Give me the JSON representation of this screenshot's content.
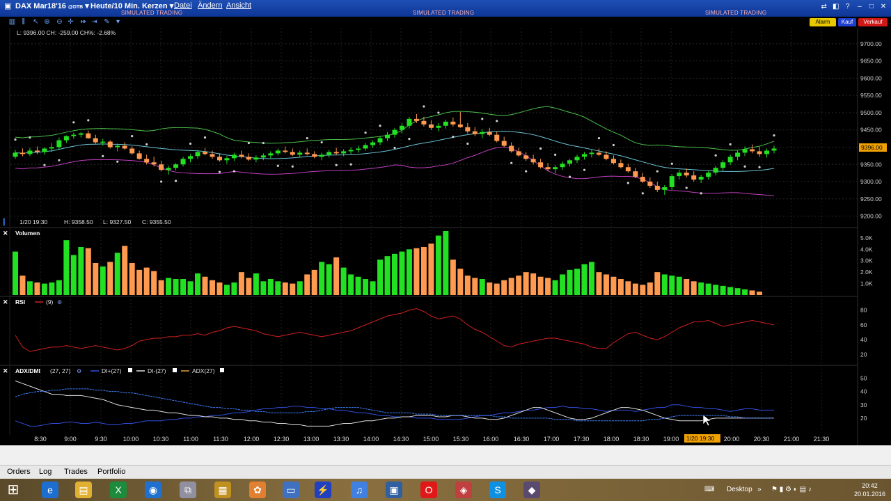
{
  "app": {
    "instrument": "DAX Mar18'16",
    "exchange": "@DTB",
    "timeframe": "Heute/10 Min. Kerzen",
    "menu": [
      "Datei",
      "Ändern",
      "Ansicht"
    ],
    "simulated": "SIMULATED TRADING"
  },
  "order_buttons": {
    "alarm": "Alarm",
    "kauf": "Kauf",
    "verkauf": "Verkauf"
  },
  "price_info": "L: 9396.00 CH: -259.00 CH%: -2.68%",
  "bar_info": {
    "time": "1/20 19:30",
    "h": "H: 9358.50",
    "l": "L: 9327.50",
    "c": "C: 9355.50"
  },
  "panels": {
    "volume": {
      "label": "Volumen"
    },
    "rsi": {
      "label": "RSI",
      "param": "(9)"
    },
    "adx": {
      "label": "ADX/DMI",
      "param": "(27, 27)",
      "di_plus": "DI+(27)",
      "di_minus": "DI-(27)",
      "adx": "ADX(27)"
    }
  },
  "colors": {
    "up": "#22e022",
    "down": "#ff9a50",
    "bb_upper": "#4cc24c",
    "bb_mid": "#6cc6d6",
    "bb_lower": "#c040c0",
    "psar": "#d0d0d0",
    "rsi": "#d02020",
    "di_plus": "#3050e0",
    "di_minus": "#e0e0e0",
    "adx_line": "#4080ff",
    "price_badge": "#f0a000",
    "time_badge": "#f0a000"
  },
  "price_axis": {
    "labels": [
      "9700.00",
      "9650.00",
      "9600.00",
      "9550.00",
      "9500.00",
      "9450.00",
      "9400.00",
      "9350.00",
      "9300.00",
      "9250.00",
      "9200.00"
    ],
    "current": "9396.00"
  },
  "volume_axis": [
    "5.0K",
    "4.0K",
    "3.0K",
    "2.0K",
    "1.0K"
  ],
  "rsi_axis": [
    "80",
    "60",
    "40",
    "20"
  ],
  "adx_axis": [
    "50",
    "40",
    "30",
    "20"
  ],
  "time_axis": [
    "8:30",
    "9:00",
    "9:30",
    "10:00",
    "10:30",
    "11:00",
    "11:30",
    "12:00",
    "12:30",
    "13:00",
    "13:30",
    "14:00",
    "14:30",
    "15:00",
    "15:30",
    "16:00",
    "16:30",
    "17:00",
    "17:30",
    "18:00",
    "18:30",
    "19:00",
    "20:00",
    "20:30",
    "21:00",
    "21:30"
  ],
  "time_badge": "1/20 19:30",
  "bottom_tabs": [
    "Orders",
    "Log",
    "Trades",
    "Portfolio"
  ],
  "taskbar": {
    "desktop": "Desktop",
    "time": "20:42",
    "date": "20.01.2016"
  },
  "chart_data": {
    "type": "candlestick",
    "y_range": [
      9185,
      9730
    ],
    "candles": [
      [
        9372,
        9392,
        9366,
        9384
      ],
      [
        9384,
        9396,
        9374,
        9380
      ],
      [
        9380,
        9398,
        9374,
        9390
      ],
      [
        9390,
        9402,
        9380,
        9386
      ],
      [
        9386,
        9400,
        9378,
        9396
      ],
      [
        9396,
        9412,
        9386,
        9400
      ],
      [
        9400,
        9428,
        9392,
        9420
      ],
      [
        9420,
        9434,
        9412,
        9432
      ],
      [
        9432,
        9442,
        9424,
        9436
      ],
      [
        9436,
        9444,
        9428,
        9440
      ],
      [
        9440,
        9448,
        9424,
        9426
      ],
      [
        9426,
        9436,
        9410,
        9414
      ],
      [
        9414,
        9424,
        9404,
        9416
      ],
      [
        9416,
        9420,
        9396,
        9400
      ],
      [
        9400,
        9410,
        9388,
        9404
      ],
      [
        9404,
        9414,
        9392,
        9396
      ],
      [
        9396,
        9402,
        9378,
        9382
      ],
      [
        9382,
        9390,
        9364,
        9366
      ],
      [
        9366,
        9378,
        9350,
        9356
      ],
      [
        9356,
        9372,
        9344,
        9350
      ],
      [
        9350,
        9360,
        9330,
        9334
      ],
      [
        9334,
        9346,
        9320,
        9340
      ],
      [
        9340,
        9354,
        9332,
        9350
      ],
      [
        9350,
        9372,
        9344,
        9366
      ],
      [
        9366,
        9380,
        9356,
        9374
      ],
      [
        9374,
        9392,
        9366,
        9386
      ],
      [
        9386,
        9398,
        9376,
        9380
      ],
      [
        9380,
        9390,
        9366,
        9372
      ],
      [
        9372,
        9382,
        9358,
        9362
      ],
      [
        9362,
        9374,
        9352,
        9368
      ],
      [
        9368,
        9384,
        9360,
        9378
      ],
      [
        9378,
        9390,
        9368,
        9372
      ],
      [
        9372,
        9382,
        9360,
        9364
      ],
      [
        9364,
        9376,
        9356,
        9370
      ],
      [
        9370,
        9382,
        9362,
        9376
      ],
      [
        9376,
        9388,
        9368,
        9382
      ],
      [
        9382,
        9396,
        9376,
        9390
      ],
      [
        9390,
        9402,
        9382,
        9386
      ],
      [
        9386,
        9396,
        9374,
        9378
      ],
      [
        9378,
        9390,
        9370,
        9384
      ],
      [
        9384,
        9396,
        9376,
        9380
      ],
      [
        9380,
        9388,
        9368,
        9372
      ],
      [
        9372,
        9384,
        9362,
        9378
      ],
      [
        9378,
        9392,
        9370,
        9386
      ],
      [
        9386,
        9398,
        9378,
        9382
      ],
      [
        9382,
        9394,
        9374,
        9388
      ],
      [
        9388,
        9400,
        9380,
        9392
      ],
      [
        9392,
        9404,
        9384,
        9396
      ],
      [
        9396,
        9412,
        9390,
        9406
      ],
      [
        9406,
        9420,
        9398,
        9414
      ],
      [
        9414,
        9432,
        9406,
        9426
      ],
      [
        9426,
        9444,
        9418,
        9436
      ],
      [
        9436,
        9456,
        9428,
        9450
      ],
      [
        9450,
        9470,
        9440,
        9462
      ],
      [
        9462,
        9488,
        9454,
        9482
      ],
      [
        9482,
        9496,
        9470,
        9476
      ],
      [
        9476,
        9488,
        9460,
        9466
      ],
      [
        9466,
        9478,
        9450,
        9456
      ],
      [
        9456,
        9470,
        9446,
        9462
      ],
      [
        9462,
        9480,
        9454,
        9474
      ],
      [
        9474,
        9486,
        9460,
        9466
      ],
      [
        9466,
        9502,
        9456,
        9458
      ],
      [
        9458,
        9470,
        9440,
        9446
      ],
      [
        9446,
        9458,
        9432,
        9438
      ],
      [
        9438,
        9452,
        9426,
        9444
      ],
      [
        9444,
        9456,
        9432,
        9436
      ],
      [
        9436,
        9446,
        9414,
        9418
      ],
      [
        9418,
        9430,
        9400,
        9404
      ],
      [
        9404,
        9414,
        9384,
        9388
      ],
      [
        9388,
        9398,
        9372,
        9376
      ],
      [
        9376,
        9386,
        9360,
        9366
      ],
      [
        9366,
        9378,
        9350,
        9356
      ],
      [
        9356,
        9366,
        9338,
        9342
      ],
      [
        9342,
        9354,
        9330,
        9336
      ],
      [
        9336,
        9348,
        9324,
        9342
      ],
      [
        9342,
        9358,
        9334,
        9352
      ],
      [
        9352,
        9366,
        9344,
        9362
      ],
      [
        9362,
        9378,
        9354,
        9372
      ],
      [
        9372,
        9386,
        9364,
        9380
      ],
      [
        9380,
        9392,
        9370,
        9384
      ],
      [
        9384,
        9396,
        9374,
        9378
      ],
      [
        9378,
        9388,
        9362,
        9366
      ],
      [
        9366,
        9376,
        9350,
        9354
      ],
      [
        9354,
        9364,
        9338,
        9342
      ],
      [
        9342,
        9352,
        9326,
        9330
      ],
      [
        9330,
        9340,
        9310,
        9314
      ],
      [
        9314,
        9326,
        9296,
        9300
      ],
      [
        9300,
        9312,
        9282,
        9288
      ],
      [
        9288,
        9300,
        9270,
        9276
      ],
      [
        9276,
        9290,
        9262,
        9284
      ],
      [
        9284,
        9322,
        9276,
        9316
      ],
      [
        9316,
        9334,
        9306,
        9326
      ],
      [
        9326,
        9338,
        9312,
        9318
      ],
      [
        9318,
        9330,
        9300,
        9306
      ],
      [
        9306,
        9320,
        9296,
        9314
      ],
      [
        9314,
        9332,
        9306,
        9326
      ],
      [
        9326,
        9346,
        9318,
        9340
      ],
      [
        9340,
        9362,
        9332,
        9356
      ],
      [
        9356,
        9378,
        9348,
        9372
      ],
      [
        9372,
        9390,
        9362,
        9384
      ],
      [
        9384,
        9402,
        9374,
        9394
      ],
      [
        9394,
        9408,
        9382,
        9388
      ],
      [
        9388,
        9400,
        9372,
        9380
      ],
      [
        9380,
        9396,
        9370,
        9390
      ],
      [
        9390,
        9404,
        9382,
        9396
      ]
    ],
    "volume": [
      3800,
      1700,
      1200,
      1100,
      1000,
      1100,
      1300,
      4800,
      3500,
      4200,
      4100,
      2800,
      2500,
      2900,
      3700,
      4300,
      2800,
      2200,
      2400,
      2100,
      1300,
      1500,
      1400,
      1400,
      1200,
      1900,
      1600,
      1300,
      1100,
      900,
      1100,
      2000,
      1500,
      1900,
      1200,
      1400,
      1200,
      1100,
      1000,
      1200,
      1800,
      2200,
      2900,
      2700,
      3300,
      2400,
      1800,
      1600,
      1400,
      1200,
      3100,
      3400,
      3600,
      3800,
      4000,
      4100,
      4200,
      4500,
      5200,
      5600,
      3100,
      2300,
      1700,
      1500,
      1400,
      1100,
      1000,
      1300,
      1500,
      1700,
      2000,
      1900,
      1600,
      1500,
      1300,
      1800,
      2200,
      2300,
      2700,
      2900,
      2000,
      1800,
      1600,
      1400,
      1200,
      1000,
      900,
      1100,
      2000,
      1800,
      1700,
      1600,
      1400,
      1200,
      1100,
      1000,
      900,
      800,
      700,
      600,
      500,
      400,
      300
    ],
    "rsi": [
      46,
      30,
      24,
      26,
      28,
      30,
      30,
      32,
      30,
      28,
      30,
      32,
      30,
      28,
      26,
      28,
      32,
      38,
      40,
      42,
      42,
      44,
      44,
      46,
      46,
      48,
      46,
      50,
      52,
      56,
      58,
      56,
      54,
      52,
      48,
      46,
      44,
      46,
      48,
      50,
      48,
      46,
      44,
      46,
      48,
      50,
      52,
      56,
      60,
      64,
      68,
      72,
      74,
      76,
      80,
      82,
      78,
      72,
      68,
      70,
      72,
      68,
      60,
      54,
      50,
      44,
      38,
      32,
      30,
      34,
      36,
      38,
      40,
      42,
      42,
      40,
      38,
      36,
      34,
      30,
      28,
      28,
      36,
      42,
      48,
      50,
      46,
      42,
      40,
      44,
      50,
      56,
      60,
      64,
      64,
      66,
      62,
      58,
      60,
      62,
      64,
      66,
      64,
      62,
      60
    ],
    "di_plus": [
      18,
      16,
      14,
      14,
      15,
      16,
      16,
      17,
      17,
      16,
      16,
      17,
      16,
      15,
      15,
      16,
      16,
      17,
      18,
      18,
      18,
      19,
      19,
      20,
      20,
      21,
      21,
      22,
      22,
      23,
      24,
      24,
      25,
      26,
      27,
      27,
      28,
      28,
      29,
      29,
      28,
      28,
      27,
      27,
      26,
      26,
      25,
      24,
      24,
      23,
      22,
      22,
      21,
      21,
      21,
      20,
      20,
      20,
      19,
      19,
      19,
      19,
      20,
      21,
      22,
      22,
      23,
      24,
      24,
      25,
      26,
      26,
      27,
      28,
      28,
      29,
      28,
      28,
      27,
      27,
      26,
      25,
      26,
      26,
      26,
      25,
      26,
      27,
      28,
      28,
      30,
      30,
      29,
      28,
      28,
      27,
      27,
      26,
      25,
      26,
      27,
      27,
      26,
      26,
      26
    ],
    "di_minus": [
      48,
      46,
      44,
      42,
      40,
      38,
      38,
      37,
      37,
      37,
      36,
      35,
      34,
      32,
      30,
      29,
      28,
      27,
      26,
      26,
      25,
      24,
      24,
      23,
      22,
      22,
      21,
      21,
      20,
      20,
      19,
      19,
      18,
      18,
      17,
      17,
      16,
      16,
      15,
      15,
      14,
      14,
      14,
      14,
      15,
      16,
      16,
      17,
      18,
      18,
      19,
      20,
      20,
      21,
      21,
      22,
      22,
      22,
      21,
      21,
      22,
      22,
      21,
      20,
      20,
      19,
      19,
      20,
      22,
      24,
      26,
      28,
      28,
      26,
      24,
      22,
      20,
      19,
      19,
      20,
      22,
      24,
      26,
      28,
      28,
      27,
      26,
      24,
      22,
      20,
      19,
      18,
      18,
      18,
      18,
      19,
      20,
      20,
      20,
      20,
      20,
      20,
      20,
      20,
      20
    ],
    "adx": [
      36,
      38,
      39,
      40,
      40,
      41,
      41,
      42,
      42,
      42,
      42,
      41,
      41,
      40,
      40,
      39,
      39,
      38,
      37,
      36,
      35,
      34,
      33,
      32,
      31,
      30,
      29,
      28,
      28,
      27,
      27,
      26,
      26,
      25,
      25,
      24,
      24,
      24,
      24,
      24,
      25,
      25,
      26,
      27,
      28,
      28,
      28,
      28,
      27,
      26,
      25,
      24,
      24,
      24,
      24,
      23,
      23,
      23,
      22,
      22,
      22,
      22,
      22,
      22,
      22,
      22,
      21,
      21,
      20,
      20,
      20,
      20,
      20,
      20,
      19,
      19,
      19,
      18,
      18,
      18,
      18,
      18,
      18,
      18,
      18,
      18,
      18,
      19,
      19,
      20,
      21,
      22,
      22,
      22,
      22,
      22,
      22,
      22,
      21,
      21,
      20,
      20,
      20,
      20,
      20
    ]
  }
}
